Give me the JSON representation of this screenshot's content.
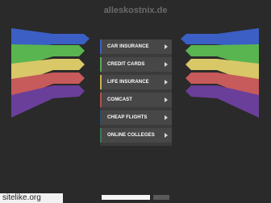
{
  "site": {
    "title": "alleskostnix.de"
  },
  "menu": {
    "items": [
      {
        "label": "CAR INSURANCE",
        "accent": "#3b63c4"
      },
      {
        "label": "CREDIT CARDS",
        "accent": "#58a858"
      },
      {
        "label": "LIFE INSURANCE",
        "accent": "#c9b24a"
      },
      {
        "label": "COMCAST",
        "accent": "#b85050"
      },
      {
        "label": "CHEAP FLIGHTS",
        "accent": "#2b4f6a"
      },
      {
        "label": "ONLINE COLLEGES",
        "accent": "#3a7a5a"
      }
    ]
  },
  "footer": {
    "watermark": "sitelike.org"
  },
  "colors": {
    "background": "#2a2a2a",
    "band_blue": "#3b5fc4",
    "band_green": "#59b54f",
    "band_yellow": "#d9c867",
    "band_red": "#c75a5a",
    "band_purple": "#6a3f9a"
  }
}
